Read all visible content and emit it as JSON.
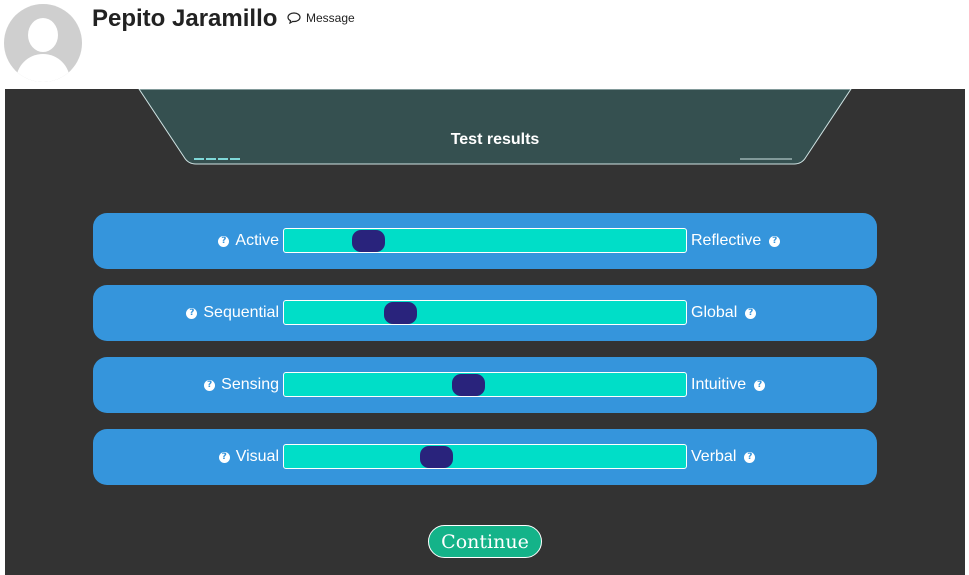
{
  "header": {
    "username": "Pepito Jaramillo",
    "message_label": "Message",
    "message_icon": "speech-bubble-icon",
    "avatar_icon": "user-placeholder-icon"
  },
  "results": {
    "title": "Test results",
    "rows": [
      {
        "left": "Active",
        "right": "Reflective",
        "position": 0.21
      },
      {
        "left": "Sequential",
        "right": "Global",
        "position": 0.29
      },
      {
        "left": "Sensing",
        "right": "Intuitive",
        "position": 0.46
      },
      {
        "left": "Visual",
        "right": "Verbal",
        "position": 0.38
      }
    ]
  },
  "continue_label": "Continue",
  "colors": {
    "panel_background": "#333333",
    "row_background": "#3595dc",
    "track": "#00dec8",
    "thumb": "#29237c",
    "tab_background": "#355050",
    "continue_button": "#14b389",
    "help_icon": "question-circle-icon"
  }
}
